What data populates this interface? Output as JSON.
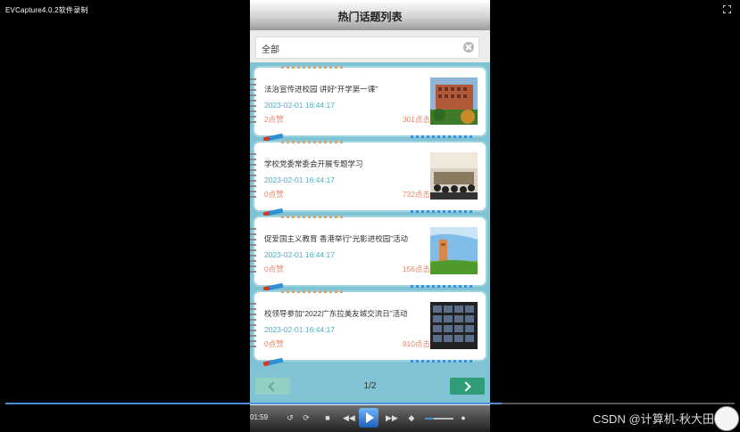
{
  "window": {
    "title": "EVCapture4.0.2软件录制"
  },
  "header": {
    "title": "热门话题列表"
  },
  "search": {
    "value": "全部"
  },
  "topics": [
    {
      "title": "法治宣传进校园 讲好“开学第一课”",
      "time": "2023-02-01 16:44:17",
      "likes": "2点赞",
      "views": "301点击"
    },
    {
      "title": "学校党委常委会开展专题学习",
      "time": "2023-02-01 16:44:17",
      "likes": "0点赞",
      "views": "732点击"
    },
    {
      "title": "促爱国主义教育 香港举行“光影进校园”活动",
      "time": "2023-02-01 16:44:17",
      "likes": "0点赞",
      "views": "156点击"
    },
    {
      "title": "校领导参加“2022广东拉美友城交流日”活动",
      "time": "2023-02-01 16:44:17",
      "likes": "0点赞",
      "views": "910点击"
    }
  ],
  "pager": {
    "label": "1/2"
  },
  "player": {
    "time": "01:59",
    "progress": 0.68,
    "volume": 0.3
  },
  "watermark": {
    "text": "CSDN @计算机-秋大田"
  },
  "colors": {
    "accent": "#4d8fd6",
    "list_bg": "#7fc3d4",
    "next_button": "#2f9e78",
    "meta": "#4aaec7",
    "count": "#e8846a"
  }
}
